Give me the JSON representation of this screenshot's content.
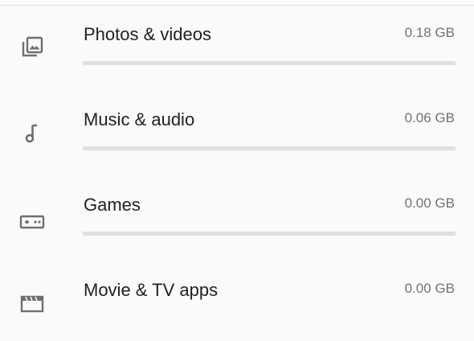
{
  "storage": {
    "categories": [
      {
        "label": "Photos & videos",
        "size": "0.18 GB",
        "icon": "photo-library-icon",
        "fill_percent": 0
      },
      {
        "label": "Music & audio",
        "size": "0.06 GB",
        "icon": "music-note-icon",
        "fill_percent": 0
      },
      {
        "label": "Games",
        "size": "0.00 GB",
        "icon": "gamepad-icon",
        "fill_percent": 0
      },
      {
        "label": "Movie & TV apps",
        "size": "0.00 GB",
        "icon": "movie-icon",
        "fill_percent": 0
      }
    ]
  },
  "colors": {
    "background": "#fafafa",
    "text_primary": "#212121",
    "text_secondary": "#727272",
    "icon": "#6f6f6f",
    "bar_track": "#e0e0e0"
  }
}
